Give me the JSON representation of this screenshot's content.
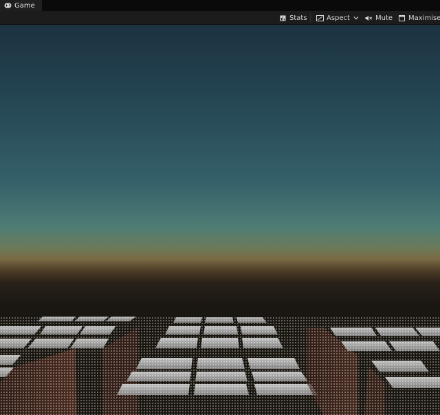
{
  "window": {
    "tab_label": "Game",
    "tab_icon": "gamepad-icon"
  },
  "toolbar": {
    "stats_label": "Stats",
    "stats_icon": "stats-icon",
    "aspect_label": "Aspect",
    "aspect_icon": "aspect-icon",
    "aspect_dropdown_icon": "chevron-down-icon",
    "mute_label": "Mute",
    "mute_icon": "speaker-mute-icon",
    "maximise_label": "Maximise",
    "maximise_icon": "maximise-icon"
  },
  "colors": {
    "sky_top": "#1c3240",
    "sky_mid": "#34606a",
    "horizon_orange": "#7a6a44",
    "ground_dark": "#141210",
    "tile_light": "#c8c8c8",
    "tile_dark": "#7a7a7a",
    "pillar": "#4a2a20"
  }
}
